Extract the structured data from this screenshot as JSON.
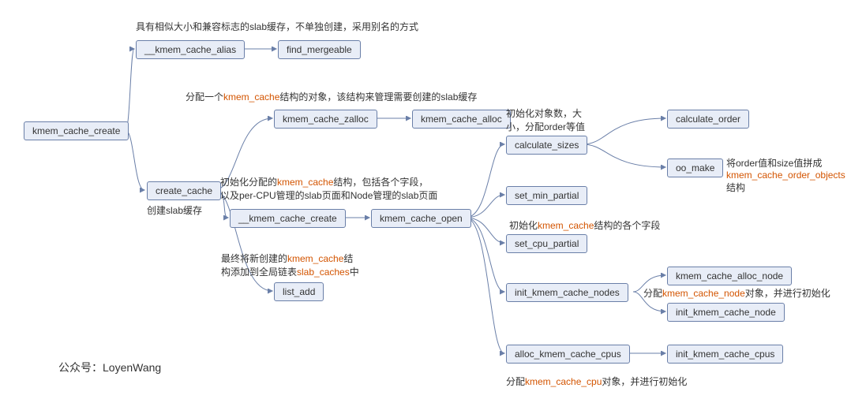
{
  "nodes": {
    "root": "kmem_cache_create",
    "alias": "__kmem_cache_alias",
    "find_mergeable": "find_mergeable",
    "create_cache": "create_cache",
    "zalloc": "kmem_cache_zalloc",
    "alloc": "kmem_cache_alloc",
    "cache_create": "__kmem_cache_create",
    "cache_open": "kmem_cache_open",
    "list_add": "list_add",
    "calc_sizes": "calculate_sizes",
    "calc_order": "calculate_order",
    "oo_make": "oo_make",
    "set_min_partial": "set_min_partial",
    "set_cpu_partial": "set_cpu_partial",
    "init_nodes": "init_kmem_cache_nodes",
    "alloc_node": "kmem_cache_alloc_node",
    "init_node": "init_kmem_cache_node",
    "alloc_cpus": "alloc_kmem_cache_cpus",
    "init_cpus": "init_kmem_cache_cpus"
  },
  "annotations": {
    "a_alias": "具有相似大小和兼容标志的slab缓存，不单独创建，采用别名的方式",
    "a_create_cache": "创建slab缓存",
    "a_zalloc_pre": "分配一个",
    "a_zalloc_hl": "kmem_cache",
    "a_zalloc_post": "结构的对象，该结构来管理需要创建的slab缓存",
    "a_cache_create_pre": "初始化分配的",
    "a_cache_create_hl": "kmem_cache",
    "a_cache_create_post1": "结构，包括各个字段，",
    "a_cache_create_post2": "以及per-CPU管理的slab页面和Node管理的slab页面",
    "a_list_add_pre": "最终将新创建的",
    "a_list_add_hl1": "kmem_cache",
    "a_list_add_mid": "结",
    "a_list_add_line2a": "构添加到全局链表",
    "a_list_add_hl2": "slab_caches",
    "a_list_add_line2b": "中",
    "a_calc_sizes_l1": "初始化对象数，大",
    "a_calc_sizes_l2": "小，分配order等值",
    "a_oo_make_l1": "将order值和size值拼成",
    "a_oo_make_hl": "kmem_cache_order_objects",
    "a_oo_make_post": "结构",
    "a_set_cpu_pre": "初始化",
    "a_set_cpu_hl": "kmem_cache",
    "a_set_cpu_post": "结构的各个字段",
    "a_init_nodes_pre": "分配",
    "a_init_nodes_hl": "kmem_cache_node",
    "a_init_nodes_post": "对象，并进行初始化",
    "a_alloc_cpus_pre": "分配",
    "a_alloc_cpus_hl": "kmem_cache_cpu",
    "a_alloc_cpus_post": "对象，并进行初始化",
    "footer": "公众号：LoyenWang"
  }
}
